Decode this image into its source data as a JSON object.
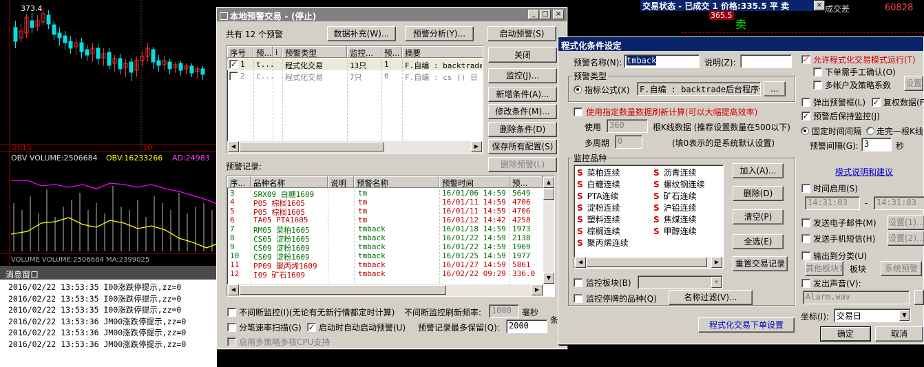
{
  "chart": {
    "price_label": "373.4",
    "year_label": "2015",
    "month_label": "10",
    "indicator": {
      "obv_volume": "OBV VOLUME:2506684",
      "obv": "OBV:16233266",
      "ad": "AD:24983"
    },
    "bottom_label": "VOLUME VOLUME:2506684  MA:2399025"
  },
  "messages": {
    "title": "消息窗口",
    "lines": [
      "2016/02/22 13:53:35  I00涨跌停提示,zz=0",
      "2016/02/22 13:53:35  I00涨跌停提示,zz=0",
      "2016/02/22 13:53:35  I00涨跌停提示,zz=0",
      "2016/02/22 13:53:36  JM00涨跌停提示,zz=0",
      "2016/02/22 13:53:36  JM00涨跌停提示,zz=0",
      "2016/02/22 13:53:36  JM00涨跌停提示,zz=0"
    ]
  },
  "trade_status": {
    "title": "交易状态 - 已成交 1 价格:335.5 平 卖",
    "bid_value": "365.5",
    "spread_label": "成交差",
    "spread_value": "60828",
    "sell_label": "卖"
  },
  "alert_window": {
    "title": "本地预警交易 - (停止)",
    "count": "共有 12 个预警",
    "btn_fill": "数据补充(W)...",
    "btn_analyze": "预警分析(Y)...",
    "btn_start": "启动预警(S)",
    "btn_close": "关闭",
    "btn_monitor": "监控(J)...",
    "btn_add": "新增条件(A)...",
    "btn_modify": "修改条件(M)...",
    "btn_delete": "删除条件(D)",
    "btn_save": "保存所有配置(S)",
    "btn_del_alert": "删除预警(L)",
    "cond_headers": [
      "序号",
      "预...",
      "i",
      "预警类型",
      "监控...",
      "预...",
      "摘要"
    ],
    "cond_rows": [
      {
        "no": "1",
        "a": "t...",
        "type": "程式化交易",
        "mon": "13只",
        "p": "1",
        "sum": "F.自编 : backtrade",
        "checked": true
      },
      {
        "no": "2",
        "a": "c...",
        "type": "程式化交易",
        "mon": "7只",
        "p": "0",
        "sum": "F.自编 : cs () 日",
        "checked": false
      }
    ],
    "record_label": "预警记录:",
    "rec_headers": [
      "序...",
      "品种名称",
      "说明",
      "预警名称",
      "预警时间",
      "预..."
    ],
    "rec_rows": [
      {
        "no": "3",
        "name": "SRX09 白糖1609",
        "alert": "tm",
        "time": "16/01/06 14:59",
        "val": "5649",
        "color": "green"
      },
      {
        "no": "4",
        "name": "P05 棕榈1605",
        "alert": "tm",
        "time": "16/01/11 14:59",
        "val": "4706",
        "color": "red"
      },
      {
        "no": "5",
        "name": "P05 棕榈1605",
        "alert": "tm",
        "time": "16/01/11 14:59",
        "val": "4706",
        "color": "red"
      },
      {
        "no": "6",
        "name": "TA05 PTA1605",
        "alert": "tm",
        "time": "16/01/12 14:42",
        "val": "4258",
        "color": "red"
      },
      {
        "no": "7",
        "name": "RM05 菜粕1605",
        "alert": "tmback",
        "time": "16/01/18 14:59",
        "val": "1973",
        "color": "green"
      },
      {
        "no": "8",
        "name": "CS05 淀粉1605",
        "alert": "tmback",
        "time": "16/01/22 14:59",
        "val": "2138",
        "color": "green"
      },
      {
        "no": "9",
        "name": "CS09 淀粉1609",
        "alert": "tmback",
        "time": "16/01/22 14:59",
        "val": "1969",
        "color": "green"
      },
      {
        "no": "10",
        "name": "CS09 淀粉1609",
        "alert": "tmback",
        "time": "16/01/25 14:59",
        "val": "1977",
        "color": "green"
      },
      {
        "no": "11",
        "name": "PP09 聚丙烯1609",
        "alert": "tmback",
        "time": "16/01/27 14:59",
        "val": "5861",
        "color": "red"
      },
      {
        "no": "12",
        "name": "I09 矿石1609",
        "alert": "tmback",
        "time": "16/02/22 09:29",
        "val": "336.0",
        "color": "red"
      }
    ],
    "opt_nonstop": "不间断监控(I)(无论有无新行情都定时计算)",
    "opt_freq_label": "不间断监控刷新频率:",
    "opt_freq_value": "1000",
    "opt_freq_unit": "毫秒",
    "opt_tick": "分笔速率扫描(G)",
    "opt_autostart": "启动时自动启动预警(U)",
    "opt_keep_label": "预警记录最多保留(Q):",
    "opt_keep_value": "2000",
    "opt_keep_unit": "条",
    "opt_multicore": "启用多策略多核CPU支持"
  },
  "cond_dialog": {
    "title": "程式化条件设定",
    "name_label": "预警名称(N):",
    "name_value": "tmback",
    "desc_label": "说明(Z):",
    "type_group": "预警类型",
    "type_radio": "指标公式(X)",
    "type_formula": "F.自编 : backtrade后台程序化",
    "type_btn": "...",
    "use_count": "使用指定数量数据刷新计算(可以大幅提高效率)",
    "use_label": "使用",
    "use_value": "360",
    "use_suffix": "根K线数据 (推荐设置数量在500以下)",
    "period_label": "多周期",
    "period_value": "0",
    "period_hint": "(填0表示的是系统默认设置)",
    "monitor_group": "监控品种",
    "varieties_col1": [
      "菜粕连续",
      "白糖连续",
      "PTA连续",
      "淀粉连续",
      "塑料连续",
      "棕榈连续",
      "聚丙烯连续"
    ],
    "varieties_col2": [
      "沥青连续",
      "螺纹钢连续",
      "矿石连续",
      "沪铅连续",
      "焦煤连续",
      "甲醇连续"
    ],
    "var_prefix": "S",
    "btn_add": "加入(A)...",
    "btn_delete": "删除(D)",
    "btn_clear": "清空(P)",
    "btn_select_all": "全选(E)",
    "btn_reset": "重置交易记录",
    "monitor_board": "监控板块(B)",
    "monitor_suspend": "监控停牌的品种(Q)",
    "btn_filter": "名称过滤(V)...",
    "btn_order": "程式化交易下单设置",
    "allow_prog": "允许程式化交易模式运行(T)",
    "manual_confirm": "下单需手工确认(O)",
    "multi_account": "多帐户及策略系数",
    "btn_settings": "设置",
    "popup": "弹出预警框(L)",
    "restore_data": "复权数据(F",
    "keep_monitor": "预警后保持监控(J)",
    "fixed_interval": "固定时间间隔",
    "finish_bar": "走完一根K线",
    "interval_label": "预警间隔(G):",
    "interval_value": "3",
    "interval_unit": "秒",
    "help_link": "模式说明和建议",
    "time_enable": "时间启用(S)",
    "time_start": "14:31:03",
    "time_end": "14:31:03",
    "time_dash": "-",
    "send_email": "发送电子邮件(M)",
    "send_sms": "发送手机短信(H)",
    "btn_set1": "设置(1)...",
    "btn_set2": "设置(2)...",
    "output_cat": "输出到分类(U)",
    "other_board": "其他板块1",
    "board_label": "板块",
    "system_alert": "系统预警",
    "play_sound": "发出声音(V):",
    "sound_file": "Alarm.wav",
    "axis_label": "坐标(I):",
    "axis_value": "交易日",
    "btn_ok": "确定",
    "btn_cancel": "取消"
  }
}
